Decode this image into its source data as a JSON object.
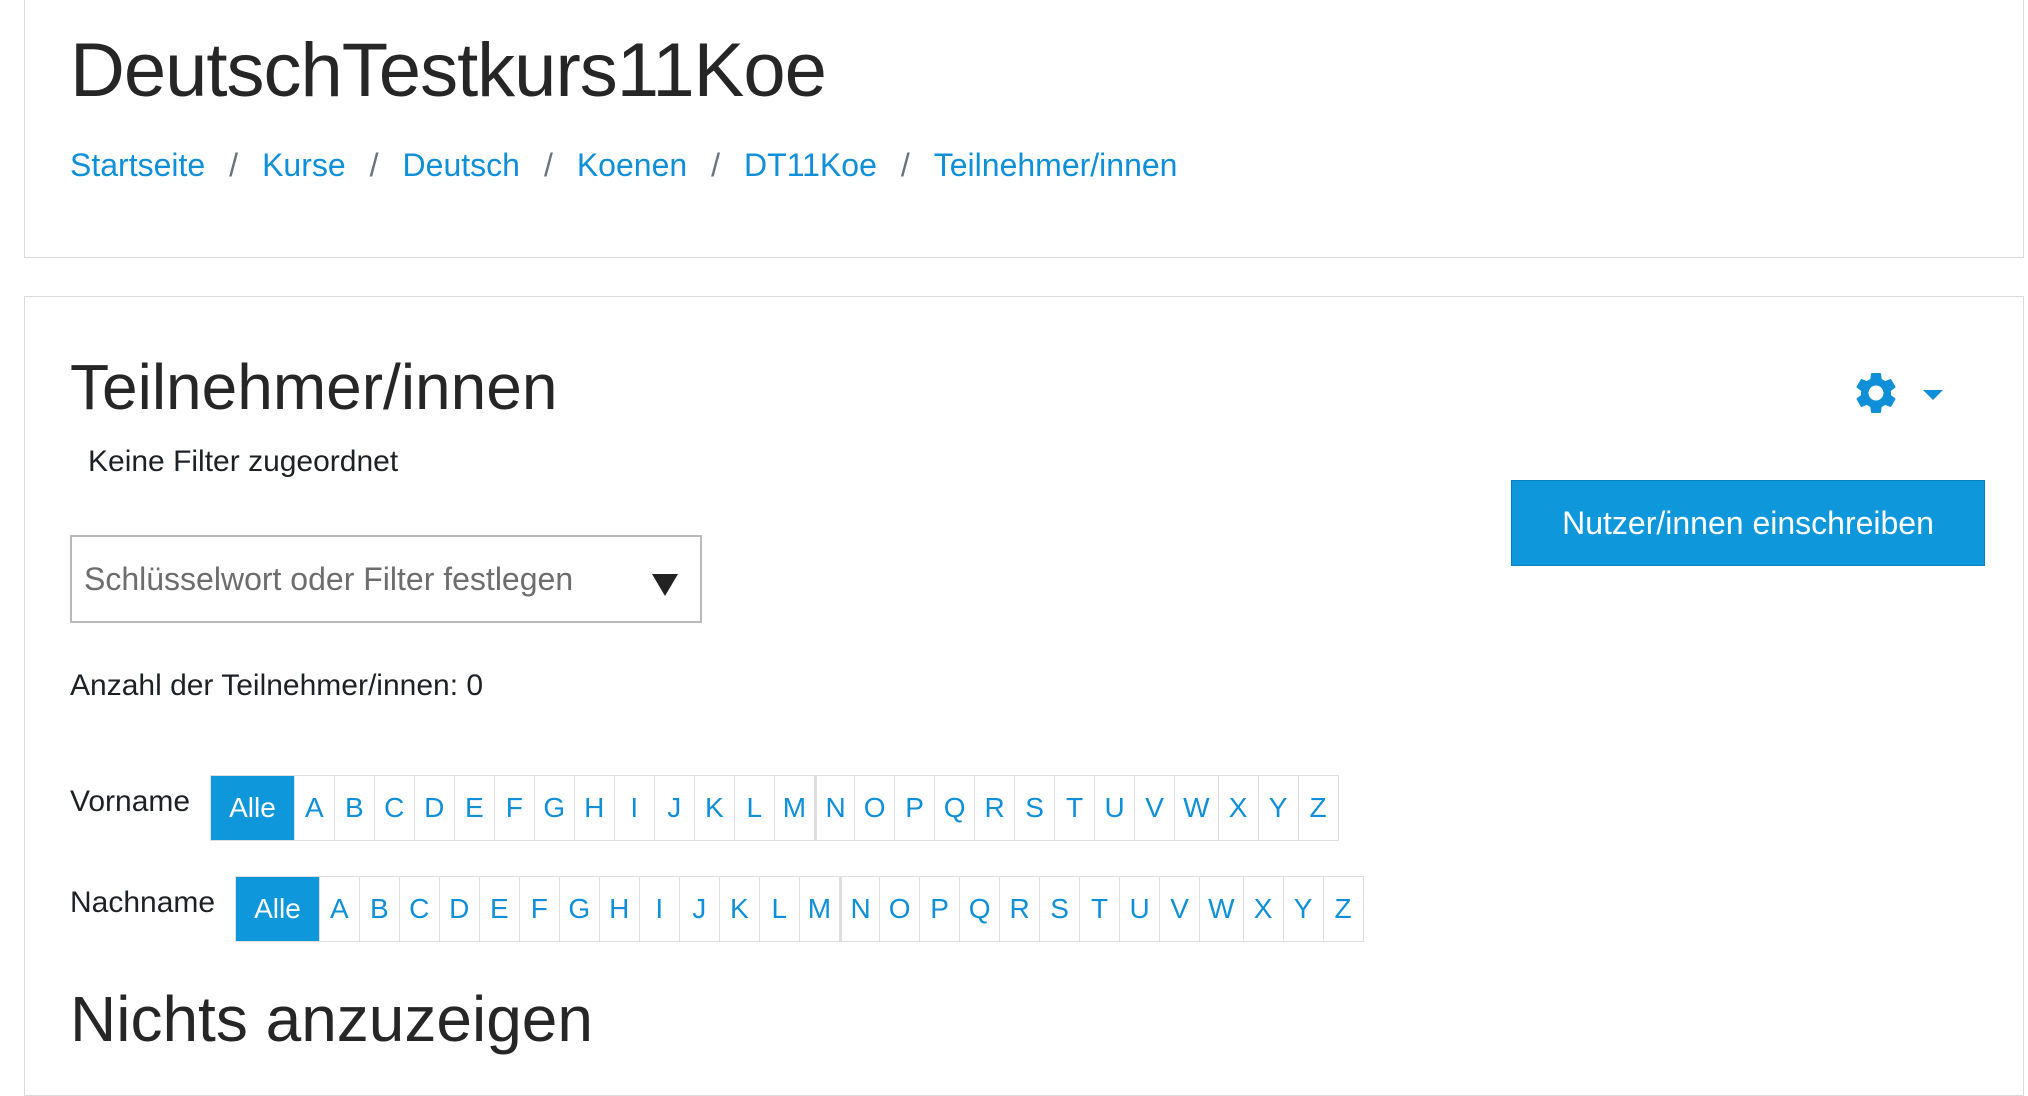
{
  "course": {
    "title": "DeutschTestkurs11Koe"
  },
  "breadcrumb": [
    {
      "label": "Startseite"
    },
    {
      "label": "Kurse"
    },
    {
      "label": "Deutsch"
    },
    {
      "label": "Koenen"
    },
    {
      "label": "DT11Koe"
    },
    {
      "label": "Teilnehmer/innen"
    }
  ],
  "breadcrumb_separator": "/",
  "participants": {
    "heading": "Teilnehmer/innen",
    "filter_status": "Keine Filter zugeordnet",
    "enrol_button": "Nutzer/innen einschreiben",
    "filter_placeholder": "Schlüsselwort oder Filter festlegen",
    "count_text": "Anzahl der Teilnehmer/innen: 0",
    "empty_message": "Nichts anzuzeigen",
    "settings_icon": "gear-icon",
    "accent_color": "#0f97dc"
  },
  "initials_filters": [
    {
      "label": "Vorname",
      "all_label": "Alle",
      "selected": "Alle",
      "letters": [
        "A",
        "B",
        "C",
        "D",
        "E",
        "F",
        "G",
        "H",
        "I",
        "J",
        "K",
        "L",
        "M",
        "N",
        "O",
        "P",
        "Q",
        "R",
        "S",
        "T",
        "U",
        "V",
        "W",
        "X",
        "Y",
        "Z"
      ]
    },
    {
      "label": "Nachname",
      "all_label": "Alle",
      "selected": "Alle",
      "letters": [
        "A",
        "B",
        "C",
        "D",
        "E",
        "F",
        "G",
        "H",
        "I",
        "J",
        "K",
        "L",
        "M",
        "N",
        "O",
        "P",
        "Q",
        "R",
        "S",
        "T",
        "U",
        "V",
        "W",
        "X",
        "Y",
        "Z"
      ]
    }
  ]
}
